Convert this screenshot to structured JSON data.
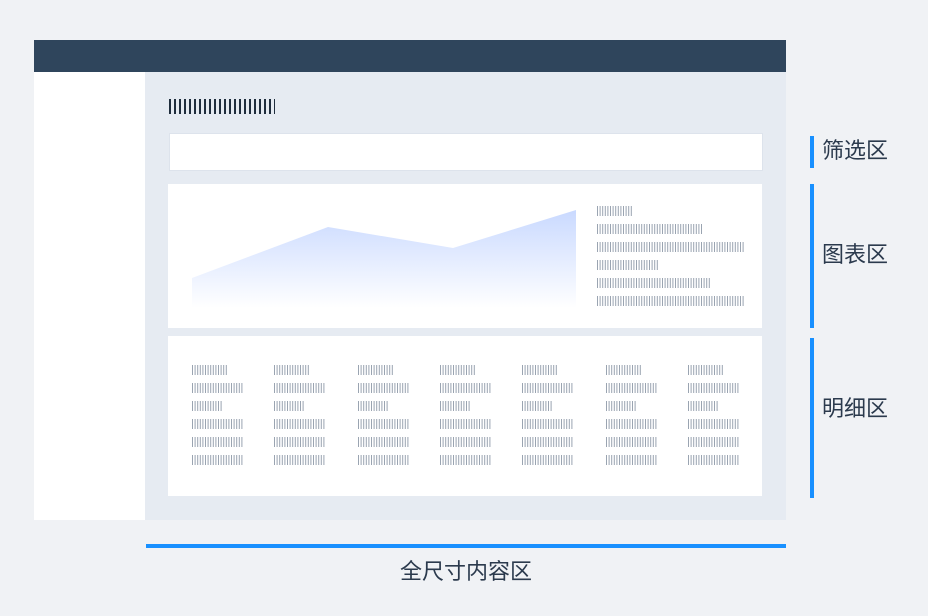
{
  "colors": {
    "background": "#f0f2f5",
    "topbar": "#2f455c",
    "content": "#e6ebf2",
    "panel": "#ffffff",
    "accent": "#1890ff",
    "placeholder_text": "#9aa4b1",
    "title_placeholder": "#1f2d3d",
    "chart_fill": "#c9d9ff"
  },
  "labels": {
    "filter_area": "筛选区",
    "chart_area": "图表区",
    "detail_area": "明细区",
    "full_content_area": "全尺寸内容区"
  },
  "icons": {
    "text_placeholder": "vertical-stripes-glyph"
  }
}
